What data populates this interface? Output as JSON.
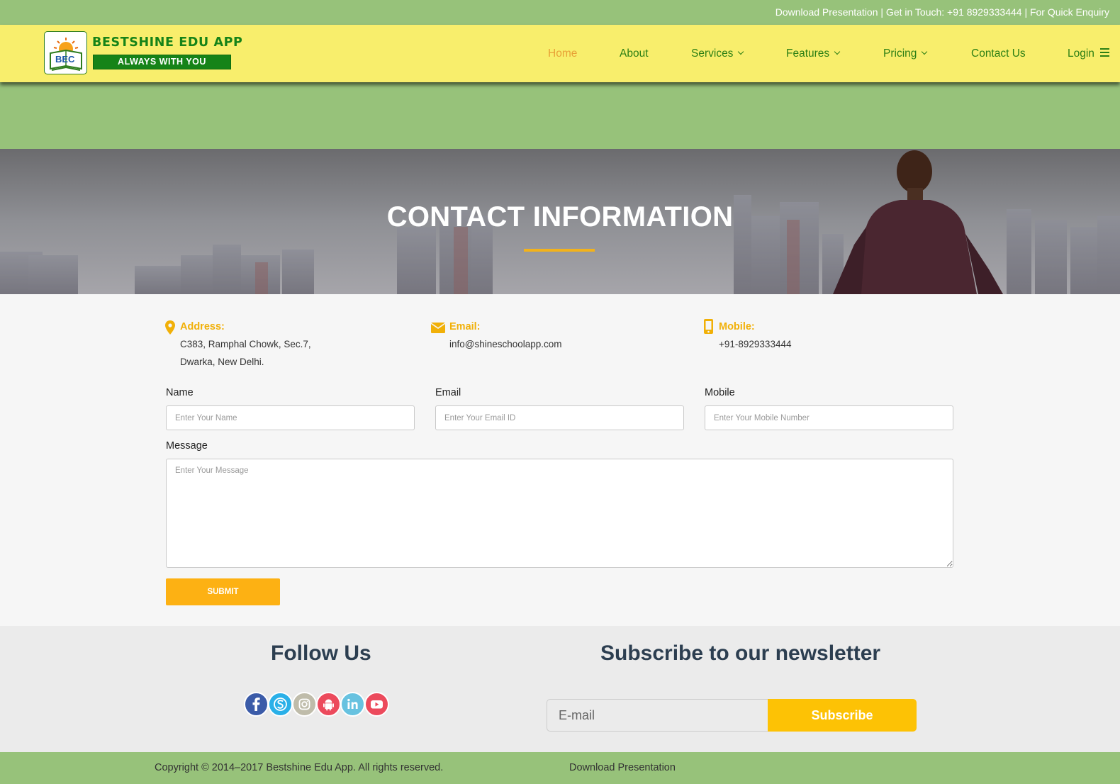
{
  "topbar": {
    "text": "Download Presentation | Get in Touch: +91 8929333444 | For Quick Enquiry"
  },
  "logo": {
    "badge_text": "BEC",
    "title": "BESTSHINE EDU APP",
    "tagline": "ALWAYS WITH YOU"
  },
  "nav": {
    "home": "Home",
    "about": "About",
    "services": "Services",
    "features": "Features",
    "pricing": "Pricing",
    "contact": "Contact Us",
    "login": "Login"
  },
  "hero": {
    "title": "CONTACT INFORMATION"
  },
  "contact_info": {
    "address_label": "Address:",
    "address_line1": "C383, Ramphal Chowk, Sec.7,",
    "address_line2": "Dwarka, New Delhi.",
    "email_label": "Email:",
    "email_value": "info@shineschoolapp.com",
    "mobile_label": "Mobile:",
    "mobile_value": "+91-8929333444"
  },
  "form": {
    "name_label": "Name",
    "name_placeholder": "Enter Your Name",
    "email_label": "Email",
    "email_placeholder": "Enter Your Email ID",
    "mobile_label": "Mobile",
    "mobile_placeholder": "Enter Your Mobile Number",
    "message_label": "Message",
    "message_placeholder": "Enter Your Message",
    "submit_label": "SUBMIT"
  },
  "follow": {
    "heading": "Follow Us",
    "icons": [
      "facebook-icon",
      "skype-icon",
      "instagram-icon",
      "android-icon",
      "linkedin-icon",
      "youtube-icon"
    ]
  },
  "newsletter": {
    "heading": "Subscribe to our newsletter",
    "placeholder": "E-mail",
    "button_label": "Subscribe"
  },
  "footer": {
    "copyright": "Copyright © 2014–2017 Bestshine Edu App. All rights reserved.",
    "download_link": "Download Presentation"
  },
  "colors": {
    "accent_green": "#97c27a",
    "header_yellow": "#f8ee6c",
    "nav_green": "#2c7f14",
    "active_orange": "#e8a035",
    "label_gold": "#f1b008",
    "submit_orange": "#fdb113",
    "subscribe_yellow": "#fdc205"
  }
}
